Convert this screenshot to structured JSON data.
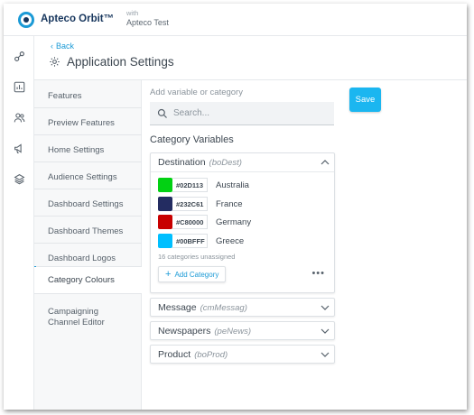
{
  "app": {
    "name": "Apteco Orbit™",
    "with_label": "with",
    "system_name": "Apteco Test"
  },
  "rail": {
    "icons": [
      "link-icon",
      "dashboard-icon",
      "audiences-icon",
      "campaign-icon",
      "layers-icon"
    ]
  },
  "header": {
    "back_label": "Back",
    "title": "Application Settings"
  },
  "nav": {
    "items": [
      {
        "label": "Features"
      },
      {
        "label": "Preview Features"
      },
      {
        "label": "Home Settings"
      },
      {
        "label": "Audience Settings"
      },
      {
        "label": "Dashboard Settings"
      },
      {
        "label": "Dashboard Themes"
      },
      {
        "label": "Dashboard Logos"
      },
      {
        "label": "Category Colours",
        "active": true
      },
      {
        "label": "Campaigning Channel Editor"
      }
    ]
  },
  "content": {
    "add_label": "Add variable or category",
    "search_placeholder": "Search...",
    "save_label": "Save",
    "section_title": "Category Variables",
    "panels": [
      {
        "name": "Destination",
        "code": "(boDest)",
        "expanded": true,
        "colors": [
          {
            "hex": "#02D113",
            "label": "Australia",
            "color": "#02D113"
          },
          {
            "hex": "#232C61",
            "label": "France",
            "color": "#232C61"
          },
          {
            "hex": "#C80000",
            "label": "Germany",
            "color": "#C80000"
          },
          {
            "hex": "#00BFFF",
            "label": "Greece",
            "color": "#00BFFF"
          }
        ],
        "unassigned": "16 categories unassigned",
        "add_label": "Add Category",
        "more_label": "•••"
      },
      {
        "name": "Message",
        "code": "(cmMessag)",
        "expanded": false
      },
      {
        "name": "Newspapers",
        "code": "(peNews)",
        "expanded": false
      },
      {
        "name": "Product",
        "code": "(boProd)",
        "expanded": false
      }
    ]
  },
  "colors": {
    "accent": "#1B9AD6",
    "save_button": "#1BB6F0",
    "brand_dark": "#17365D"
  }
}
